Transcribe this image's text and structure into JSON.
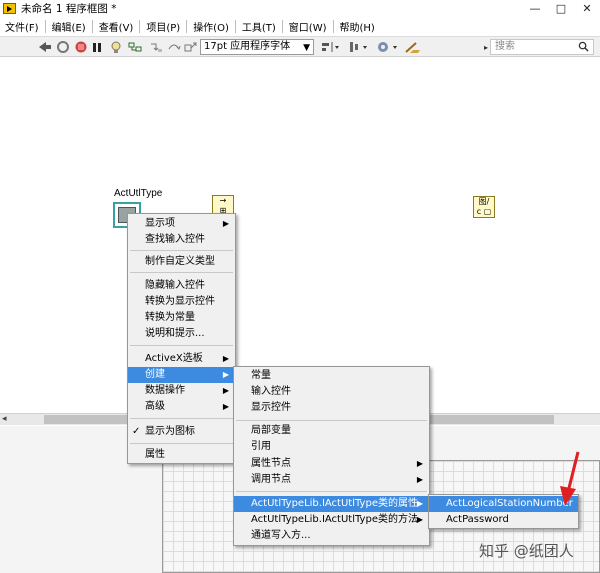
{
  "window": {
    "title": "未命名 1 程序框图 *",
    "controls": [
      "—",
      "□",
      "✕"
    ]
  },
  "menubar": {
    "items": [
      "文件(F)",
      "编辑(E)",
      "查看(V)",
      "项目(P)",
      "操作(O)",
      "工具(T)",
      "窗口(W)",
      "帮助(H)"
    ]
  },
  "toolbar": {
    "font_value": "17pt 应用程序字体",
    "search_placeholder": "搜索",
    "icons": [
      "run-arrow-icon",
      "stop-circle-icon",
      "abort-icon",
      "pause-icon",
      "highlight-bulb-icon",
      "probe-icon",
      "step-into-icon",
      "step-over-icon",
      "step-out-icon",
      "align-icon",
      "distribute-icon",
      "reorder-icon",
      "cleanup-icon",
      "search-icon"
    ]
  },
  "diagram": {
    "node_label": "ActUtlType",
    "const_top_left": "→\n⊞",
    "const_right": "图/\nc ▢"
  },
  "context_menu": {
    "items": [
      "显示项",
      "查找输入控件",
      "制作自定义类型",
      "隐藏输入控件",
      "转换为显示控件",
      "转换为常量",
      "说明和提示...",
      "ActiveX选板",
      "创建",
      "数据操作",
      "高级",
      "显示为图标",
      "属性"
    ]
  },
  "create_submenu": {
    "items": [
      "常量",
      "输入控件",
      "显示控件",
      "局部变量",
      "引用",
      "属性节点",
      "调用节点",
      "ActUtlTypeLib.IActUtlType类的属性",
      "ActUtlTypeLib.IActUtlType类的方法",
      "通道写入方..."
    ]
  },
  "property_submenu": {
    "items": [
      "ActLogicalStationNumber",
      "ActPassword"
    ]
  },
  "watermark": "知乎 @纸团人",
  "colors": {
    "highlight": "#3c8be0",
    "arrow": "#e02020",
    "node_border": "#33a3a3"
  }
}
